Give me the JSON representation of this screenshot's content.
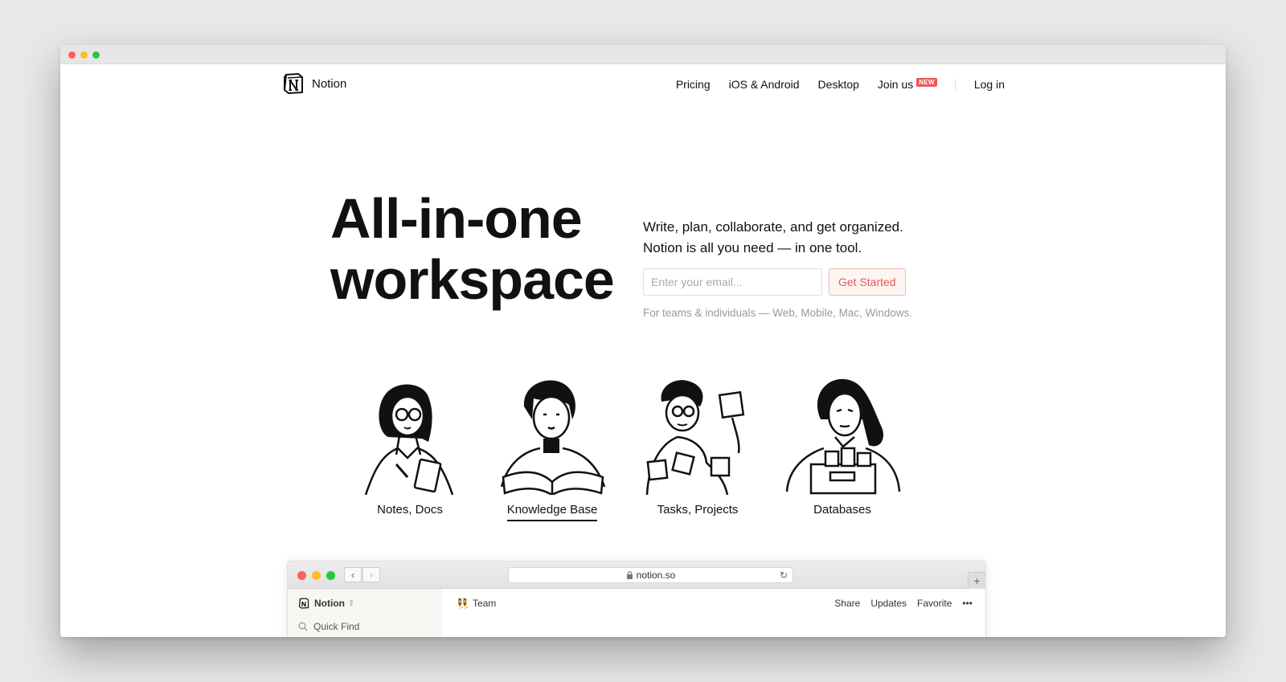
{
  "brand": {
    "name": "Notion"
  },
  "nav": {
    "links": [
      "Pricing",
      "iOS & Android",
      "Desktop",
      "Join us"
    ],
    "new_badge": "NEW",
    "login": "Log in"
  },
  "hero": {
    "title_line1": "All-in-one",
    "title_line2": "workspace",
    "tagline_line1": "Write, plan, collaborate, and get organized.",
    "tagline_line2": "Notion is all you need — in one tool.",
    "email_placeholder": "Enter your email...",
    "cta": "Get Started",
    "platforms": "For teams & individuals — Web, Mobile, Mac, Windows."
  },
  "features": [
    {
      "label": "Notes, Docs",
      "active": false
    },
    {
      "label": "Knowledge Base",
      "active": true
    },
    {
      "label": "Tasks, Projects",
      "active": false
    },
    {
      "label": "Databases",
      "active": false
    }
  ],
  "preview": {
    "url": "notion.so",
    "workspace": "Notion",
    "quick_find": "Quick Find",
    "page_emoji": "👯",
    "page_title": "Team",
    "actions": [
      "Share",
      "Updates",
      "Favorite"
    ],
    "more": "•••"
  },
  "colors": {
    "accent": "#eb5757",
    "cta_bg": "#fdf5f2",
    "traffic_red": "#fe5f57",
    "traffic_yellow": "#febc2e",
    "traffic_green": "#28c840"
  },
  "icons": {
    "logo": "notion-logo-icon",
    "lock": "lock-icon",
    "reload": "reload-icon",
    "search": "search-icon",
    "back": "chevron-left-icon",
    "forward": "chevron-right-icon"
  }
}
